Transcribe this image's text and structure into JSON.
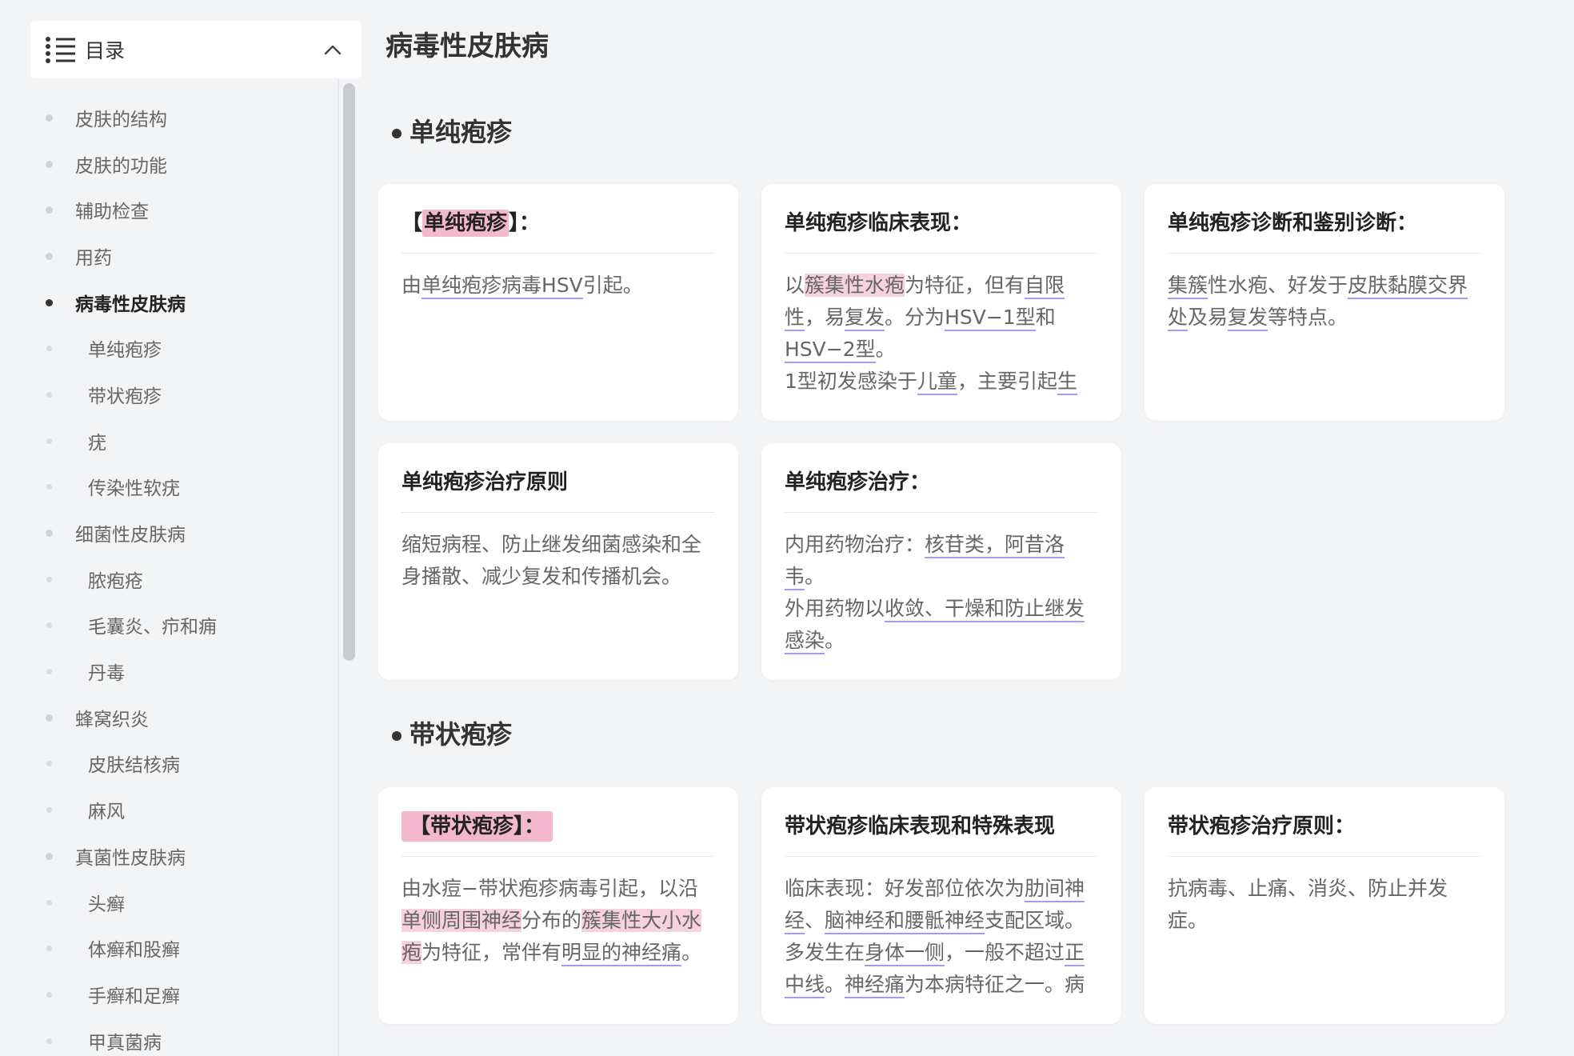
{
  "toc": {
    "title": "目录",
    "items": [
      {
        "label": "皮肤的结构",
        "level": 1
      },
      {
        "label": "皮肤的功能",
        "level": 1
      },
      {
        "label": "辅助检查",
        "level": 1
      },
      {
        "label": "用药",
        "level": 1
      },
      {
        "label": "病毒性皮肤病",
        "level": 1,
        "active": true
      },
      {
        "label": "单纯疱疹",
        "level": 2
      },
      {
        "label": "带状疱疹",
        "level": 2
      },
      {
        "label": "疣",
        "level": 2
      },
      {
        "label": "传染性软疣",
        "level": 2
      },
      {
        "label": "细菌性皮肤病",
        "level": 1
      },
      {
        "label": "脓疱疮",
        "level": 2
      },
      {
        "label": "毛囊炎、疖和痈",
        "level": 2
      },
      {
        "label": "丹毒",
        "level": 2
      },
      {
        "label": "蜂窝织炎",
        "level": 1
      },
      {
        "label": "皮肤结核病",
        "level": 2
      },
      {
        "label": "麻风",
        "level": 2
      },
      {
        "label": "真菌性皮肤病",
        "level": 1
      },
      {
        "label": "头癣",
        "level": 2
      },
      {
        "label": "体癣和股癣",
        "level": 2
      },
      {
        "label": "手癣和足癣",
        "level": 2
      },
      {
        "label": "甲真菌病",
        "level": 2
      }
    ]
  },
  "page": {
    "title": "病毒性皮肤病"
  },
  "sections": [
    {
      "heading": "单纯疱疹",
      "cards": [
        {
          "title_prefix": "【",
          "title_highlight": "单纯疱疹",
          "title_suffix": "】：",
          "body": [
            {
              "t": "由"
            },
            {
              "t": "单纯疱疹病毒HSV",
              "s": "ul"
            },
            {
              "t": "引起。"
            }
          ]
        },
        {
          "title": "单纯疱疹临床表现：",
          "body": [
            {
              "t": "以"
            },
            {
              "t": "簇集性水疱",
              "s": "hl"
            },
            {
              "t": "为特征，但有"
            },
            {
              "t": "自限",
              "s": "ul"
            },
            {
              "t": "性",
              "s": "ul"
            },
            {
              "t": "，易"
            },
            {
              "t": "复发",
              "s": "ul"
            },
            {
              "t": "。分为"
            },
            {
              "t": "HSV−1型",
              "s": "ul"
            },
            {
              "t": "和"
            },
            {
              "t": "HSV−2型",
              "s": "ul"
            },
            {
              "t": "。"
            },
            {
              "br": true
            },
            {
              "t": "1型初发感染于"
            },
            {
              "t": "儿童",
              "s": "ul"
            },
            {
              "t": "，主要引起"
            },
            {
              "t": "生",
              "s": "ul"
            }
          ]
        },
        {
          "title": "单纯疱疹诊断和鉴别诊断：",
          "body": [
            {
              "t": "集簇",
              "s": "ul"
            },
            {
              "t": "性水疱、好发于"
            },
            {
              "t": "皮肤黏膜交界",
              "s": "ul"
            },
            {
              "t": "处",
              "s": "ul"
            },
            {
              "t": "及易"
            },
            {
              "t": "复发",
              "s": "ul"
            },
            {
              "t": "等特点。"
            }
          ]
        },
        {
          "title": "单纯疱疹治疗原则",
          "body": [
            {
              "t": "缩短病程、防止继发细菌感染和全身播散、减少复发和传播机会。"
            }
          ]
        },
        {
          "title": "单纯疱疹治疗：",
          "body": [
            {
              "t": "内用药物治疗："
            },
            {
              "t": "核苷类，阿昔洛",
              "s": "ul"
            },
            {
              "t": "韦",
              "s": "ul"
            },
            {
              "t": "。"
            },
            {
              "br": true
            },
            {
              "t": "外用药物以"
            },
            {
              "t": "收敛、干燥和防止继发",
              "s": "ul"
            },
            {
              "t": "感染",
              "s": "ul"
            },
            {
              "t": "。"
            }
          ]
        }
      ]
    },
    {
      "heading": "带状疱疹",
      "cards": [
        {
          "title_badge": "【带状疱疹】：",
          "body": [
            {
              "t": "由水痘−带状疱疹病毒引起，以沿"
            },
            {
              "t": "单侧周围神经",
              "s": "hl"
            },
            {
              "t": "分布的"
            },
            {
              "t": "簇集性大小",
              "s": "hl"
            },
            {
              "t": "水疱",
              "s": "hl"
            },
            {
              "t": "为特征，常伴有"
            },
            {
              "t": "明显的神经",
              "s": "ul"
            },
            {
              "t": "痛",
              "s": "ul"
            },
            {
              "t": "。"
            }
          ]
        },
        {
          "title": "带状疱疹临床表现和特殊表现",
          "body": [
            {
              "t": "临床表现：好发部位依次为"
            },
            {
              "t": "肋间神",
              "s": "ul"
            },
            {
              "t": "经",
              "s": "ul"
            },
            {
              "t": "、"
            },
            {
              "t": "脑神经和腰骶神经",
              "s": "ul"
            },
            {
              "t": "支配区域。多发生在"
            },
            {
              "t": "身体一侧",
              "s": "ul"
            },
            {
              "t": "，一般不超过"
            },
            {
              "t": "正",
              "s": "ul"
            },
            {
              "t": "中线",
              "s": "ul"
            },
            {
              "t": "。"
            },
            {
              "t": "神经痛",
              "s": "ul"
            },
            {
              "t": "为本病特征之一。病"
            }
          ]
        },
        {
          "title": "带状疱疹治疗原则：",
          "body": [
            {
              "t": "抗病毒、止痛、消炎、防止并发症。"
            }
          ]
        }
      ]
    }
  ],
  "colors": {
    "highlight": "#f7d1df",
    "underline": "#a89af4",
    "badge": "#f3b8cd"
  }
}
